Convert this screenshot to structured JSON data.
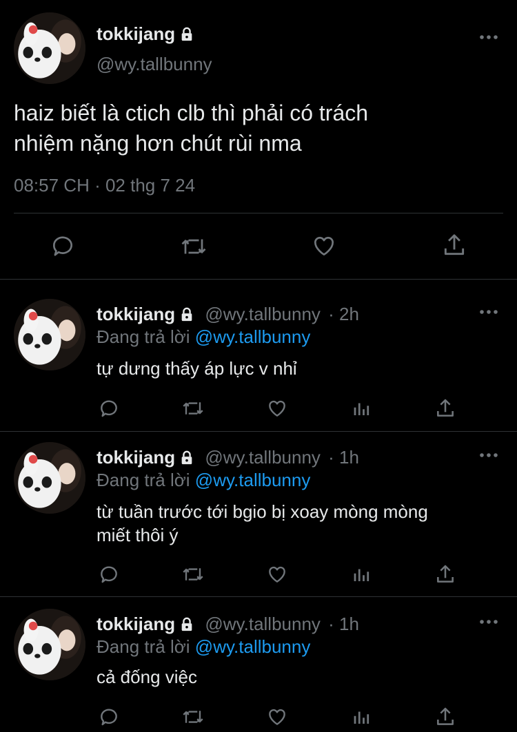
{
  "main_tweet": {
    "display_name": "tokkijang",
    "handle": "@wy.tallbunny",
    "text_line1": "haiz biết là ctich clb thì phải có trách",
    "text_line2": "nhiệm nặng hơn chút rùi nma",
    "timestamp": "08:57 CH · 02 thg 7 24",
    "icons": [
      "reply-icon",
      "retweet-icon",
      "like-icon",
      "share-icon"
    ]
  },
  "replies": [
    {
      "display_name": "tokkijang",
      "handle": "@wy.tallbunny",
      "time": "· 2h",
      "replying_prefix": "Đang trả lời",
      "replying_to": "@wy.tallbunny",
      "text_line1": "tự dưng thấy áp lực v nhỉ",
      "text_line2": ""
    },
    {
      "display_name": "tokkijang",
      "handle": "@wy.tallbunny",
      "time": "· 1h",
      "replying_prefix": "Đang trả lời",
      "replying_to": "@wy.tallbunny",
      "text_line1": "từ tuần trước tới bgio bị xoay mòng mòng",
      "text_line2": "miết thôi ý"
    },
    {
      "display_name": "tokkijang",
      "handle": "@wy.tallbunny",
      "time": "· 1h",
      "replying_prefix": "Đang trả lời",
      "replying_to": "@wy.tallbunny",
      "text_line1": "cả đống việc",
      "text_line2": ""
    }
  ],
  "reply_action_icons": [
    "reply-icon",
    "retweet-icon",
    "like-icon",
    "views-icon",
    "share-icon"
  ],
  "colors": {
    "background": "#000000",
    "text": "#e7e9ea",
    "secondary": "#71767b",
    "link": "#1d9bf0",
    "divider": "#2f3336"
  }
}
